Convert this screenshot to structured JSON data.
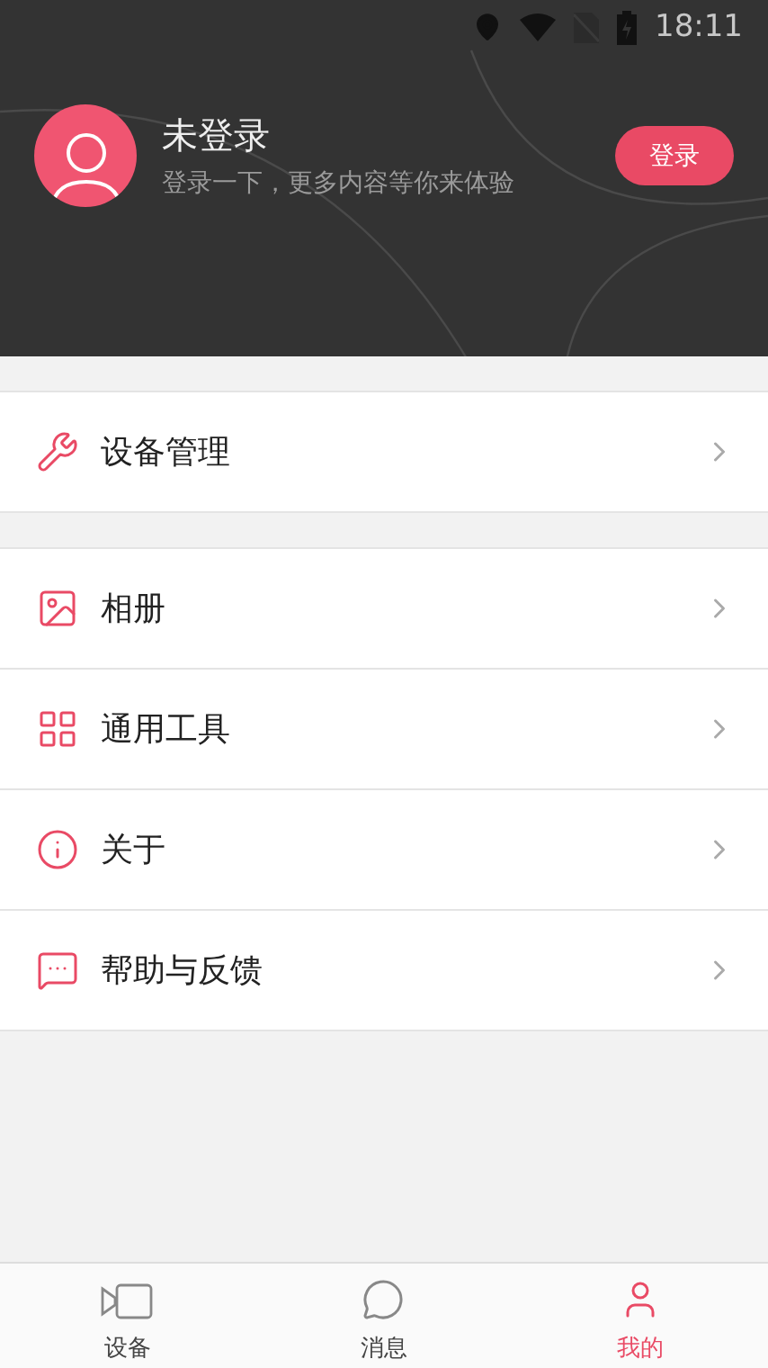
{
  "status_bar": {
    "time": "18:11"
  },
  "profile": {
    "name": "未登录",
    "subtitle": "登录一下，更多内容等你来体验",
    "login_button": "登录"
  },
  "menu_groups": [
    [
      {
        "kind": "device",
        "label": "设备管理"
      }
    ],
    [
      {
        "kind": "album",
        "label": "相册"
      },
      {
        "kind": "tools",
        "label": "通用工具"
      },
      {
        "kind": "about",
        "label": "关于"
      },
      {
        "kind": "feedback",
        "label": "帮助与反馈"
      }
    ]
  ],
  "tabs": [
    {
      "kind": "device",
      "label": "设备",
      "selected": false
    },
    {
      "kind": "message",
      "label": "消息",
      "selected": false
    },
    {
      "kind": "me",
      "label": "我的",
      "selected": true
    }
  ]
}
